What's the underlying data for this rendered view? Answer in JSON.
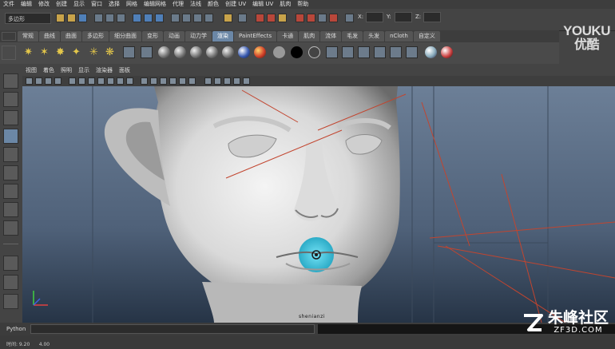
{
  "menubar": {
    "items": [
      "文件",
      "编辑",
      "修改",
      "创建",
      "显示",
      "窗口",
      "选择",
      "网格",
      "编辑网格",
      "代理",
      "法线",
      "颜色",
      "创建 UV",
      "编辑 UV",
      "肌肉",
      "帮助"
    ]
  },
  "statusline": {
    "mode": "多边形",
    "x_label": "X:",
    "y_label": "Y:",
    "z_label": "Z:"
  },
  "watermark_youku": {
    "en": "YOUKU",
    "cn": "优酷"
  },
  "shelf": {
    "tabs": [
      "常规",
      "曲线",
      "曲面",
      "多边形",
      "细分曲面",
      "变形",
      "动画",
      "动力学",
      "渲染",
      "PaintEffects",
      "卡通",
      "肌肉",
      "流体",
      "毛发",
      "头发",
      "nCloth",
      "自定义"
    ],
    "active_tab": "渲染"
  },
  "panel": {
    "menu": [
      "视图",
      "着色",
      "照明",
      "显示",
      "渲染器",
      "面板"
    ]
  },
  "viewport": {
    "model_label": "shenianzi"
  },
  "python": {
    "label": "Python"
  },
  "helpline": {
    "text": "时间: 9.20      4.00"
  },
  "watermark_site": {
    "cn": "朱峰社区",
    "url": "ZF3D.COM"
  },
  "colors": {
    "active_tab": "#6b87a6",
    "highlight": "#35b6d2",
    "guide_lines": "#c2452f"
  }
}
